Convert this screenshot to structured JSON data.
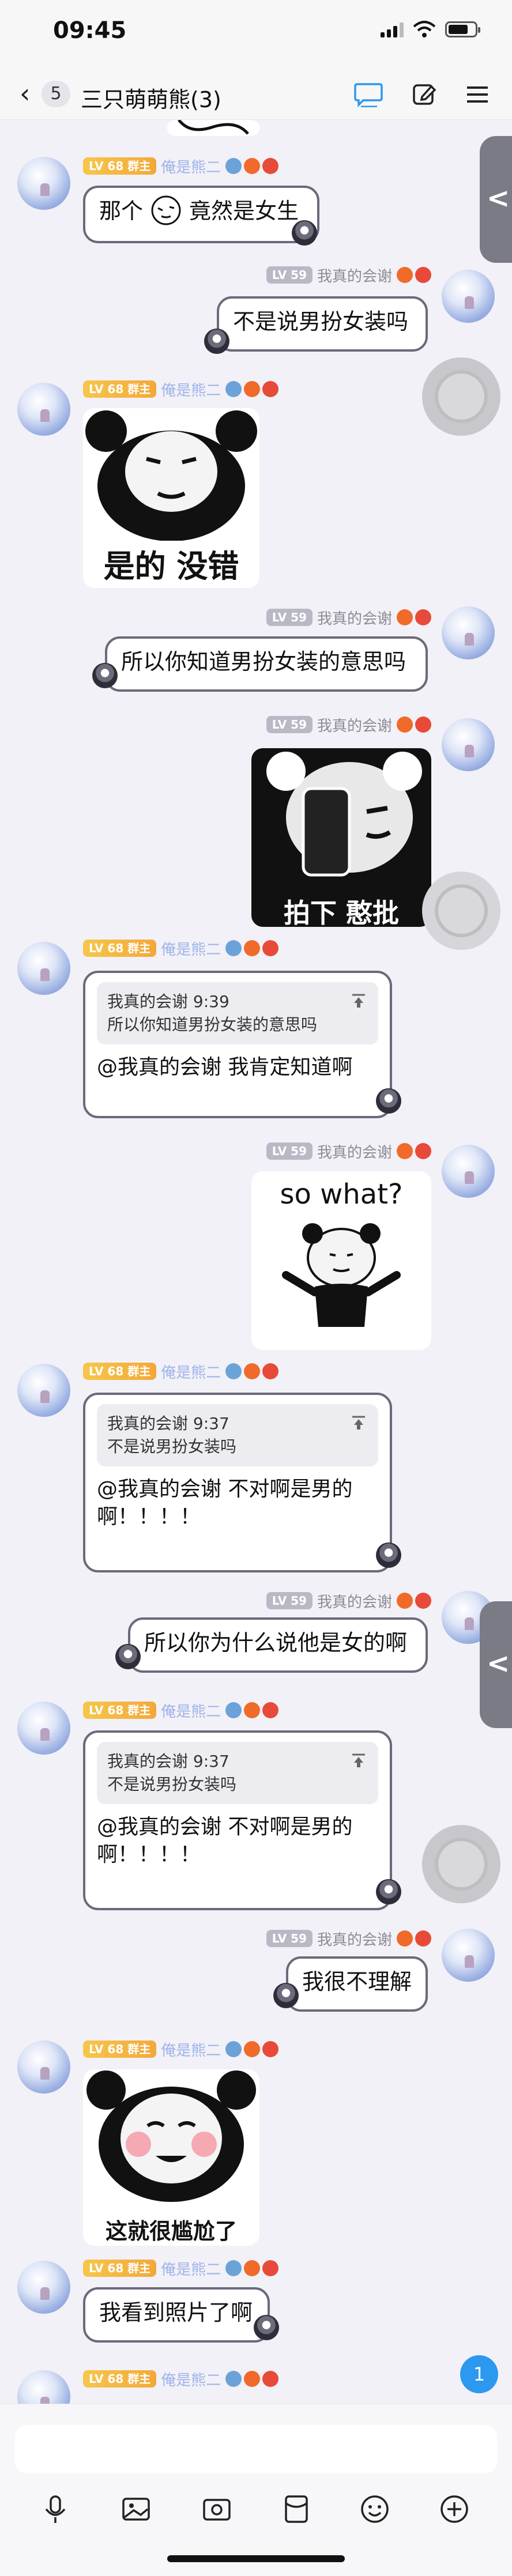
{
  "status_bar": {
    "time": "09:45"
  },
  "nav": {
    "back_count": "5",
    "title": "三只萌萌熊(3)"
  },
  "users": {
    "other": {
      "level": "LV 68",
      "role": "群主",
      "nick": "俺是熊二"
    },
    "me": {
      "level": "LV 59",
      "nick": "我真的会谢"
    }
  },
  "messages": {
    "m1": {
      "text_a": "那个",
      "text_b": "竟然是女生"
    },
    "m2": {
      "text": "不是说男扮女装吗"
    },
    "m3": {
      "caption": "是的 没错"
    },
    "m4": {
      "text": "所以你知道男扮女装的意思吗"
    },
    "m5": {
      "caption": "拍下 憨批"
    },
    "m6": {
      "quote_head": "我真的会谢 9:39",
      "quote_text": "所以你知道男扮女装的意思吗",
      "text": "@我真的会谢 我肯定知道啊"
    },
    "m7": {
      "caption": "so what?"
    },
    "m8": {
      "quote_head": "我真的会谢 9:37",
      "quote_text": "不是说男扮女装吗",
      "text": "@我真的会谢 不对啊是男的啊！！！！"
    },
    "m9": {
      "text": "所以你为什么说他是女的啊"
    },
    "m10": {
      "quote_head": "我真的会谢 9:37",
      "quote_text": "不是说男扮女装吗",
      "text": "@我真的会谢 不对啊是男的啊！！！！"
    },
    "m11": {
      "text": "我很不理解"
    },
    "m12": {
      "caption": "这就很尴尬了"
    },
    "m13": {
      "text": "我看到照片了啊"
    }
  },
  "unread_count": "1",
  "colors": {
    "accent": "#2c98f0",
    "level_gold": "#f6c64a",
    "level_gray": "#b9b9c6",
    "bubble_border": "#6a6a7a"
  }
}
